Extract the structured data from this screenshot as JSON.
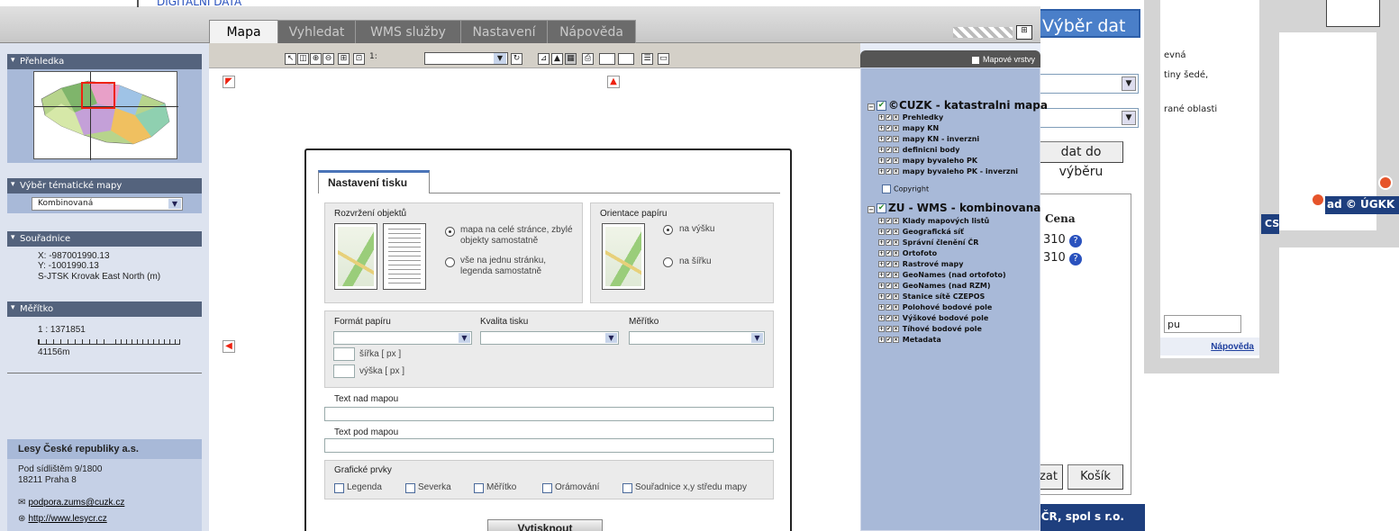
{
  "background": {
    "title_partial": "Výběr dat",
    "button_add_partial": "dat do výběru",
    "column_cena": "Cena",
    "row_values": [
      "310",
      "310"
    ],
    "button_zat_partial": "zat",
    "button_kosik": "Košík",
    "footer_partial": "h ČR, spol s r.o.",
    "text_right_1": "evná",
    "text_right_2": "tiny šedé,",
    "text_right_3": "rané oblasti",
    "label_cs": "CS s.r.o.",
    "label_ugkk": "ad © ÚGKK",
    "search_partial": "pu",
    "help_link": "Nápověda",
    "data_tree_item": "DIGITÁLNÍ DATA"
  },
  "tabs": [
    {
      "label": "Mapa"
    },
    {
      "label": "Vyhledat"
    },
    {
      "label": "WMS služby"
    },
    {
      "label": "Nastavení"
    },
    {
      "label": "Nápověda"
    }
  ],
  "left_panel": {
    "overview_title": "Přehledka",
    "theme_title": "Výběr tématické mapy",
    "theme_value": "Kombinovaná",
    "coords_title": "Souřadnice",
    "coord_x": "X: -987001990.13",
    "coord_y": "Y: -1001990.13",
    "coord_system": "S-JTSK Krovak East North (m)",
    "scale_title": "Měřítko",
    "scale_value": "1 : 1371851",
    "scale_distance": "41156m",
    "org_name": "Lesy České republiky a.s.",
    "org_street": "Pod sídlištěm 9/1800",
    "org_city": "18211 Praha 8",
    "org_email": "podpora.zums@cuzk.cz",
    "org_web": "http://www.lesycr.cz"
  },
  "toolbar": {
    "scale_prefix": "1:"
  },
  "print_dialog": {
    "tab_label": "Nastavení tisku",
    "layout_label": "Rozvržení objektů",
    "layout_option_1": "mapa na celé stránce, zbylé objekty samostatně",
    "layout_option_2": "vše na jednu stránku, legenda samostatně",
    "orientation_label": "Orientace papíru",
    "orientation_portrait": "na výšku",
    "orientation_landscape": "na šířku",
    "paper_format_label": "Formát papíru",
    "print_quality_label": "Kvalita tisku",
    "scale_label": "Měřítko",
    "width_label": "šířka [ px ]",
    "height_label": "výška [ px ]",
    "text_above_label": "Text nad mapou",
    "text_below_label": "Text pod mapou",
    "graphic_label": "Grafické prvky",
    "graphic_options": [
      "Legenda",
      "Severka",
      "Měřítko",
      "Orámování",
      "Souřadnice x,y středu mapy"
    ],
    "generate_button": "Vytisknout"
  },
  "layers_panel": {
    "title": "Mapové vrstvy",
    "group1": "©CUZK - katastralni mapa",
    "group1_items": [
      "Prehledky",
      "mapy KN",
      "mapy KN - inverzni",
      "definicni body",
      "mapy byvaleho PK",
      "mapy byvaleho PK - inverzni"
    ],
    "copyright": "Copyright",
    "group2": "ZU - WMS - kombinovana",
    "group2_items": [
      "Klady mapových listů",
      "Geografická síť",
      "Správní členění ČR",
      "Ortofoto",
      "Rastrové mapy",
      "GeoNames (nad ortofoto)",
      "GeoNames (nad RZM)",
      "Stanice sítě CZEPOS",
      "Polohové bodové pole",
      "Výškové bodové pole",
      "Tíhové bodové pole",
      "Metadata"
    ]
  }
}
